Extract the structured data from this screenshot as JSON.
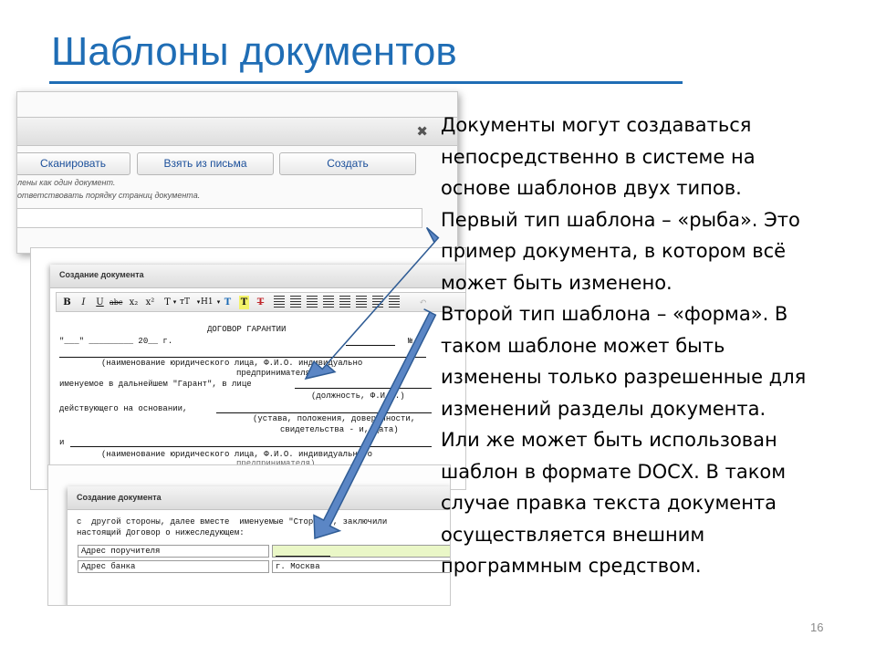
{
  "slide": {
    "title": "Шаблоны документов",
    "body_lines": [
      "Документы могут создаваться",
      "непосредственно в системе на",
      "основе шаблонов двух типов.",
      "Первый тип шаблона – «рыба». Это",
      "пример документа, в котором всё",
      "может быть изменено.",
      "Второй тип шаблона – «форма».  В",
      "таком шаблоне может быть",
      "изменены только разрешенные для",
      "изменений разделы документа.",
      "Или же может быть использован",
      "шаблон в формате DOCX. В таком",
      "случае правка текста документа",
      "осуществляется внешним",
      "программным средством."
    ],
    "page_number": "16"
  },
  "screenshot1": {
    "close_icon": "close-icon",
    "buttons": {
      "scan": "Сканировать",
      "from_mail": "Взять из письма",
      "create": "Создать"
    },
    "notes": [
      "лены как один документ.",
      "ответствовать порядку страниц документа."
    ]
  },
  "screenshot2": {
    "dialog_title": "Создание документа",
    "toolbar": {
      "bold": "B",
      "italic": "I",
      "underline": "U",
      "strike": "abc",
      "subscript": "x₂",
      "superscript": "x²",
      "font_family": "T",
      "font_size": "тT",
      "heading": "H1",
      "icons": [
        "text-color-icon",
        "highlight-icon",
        "clear-format-icon",
        "bullet-list-icon",
        "numbered-list-icon",
        "outdent-icon",
        "indent-icon",
        "align-left-icon",
        "align-center-icon",
        "align-right-icon",
        "justify-icon",
        "undo-icon"
      ]
    },
    "document_lines": {
      "heading": "ДОГОВОР ГАРАНТИИ",
      "date_line": "\"___\" _________ 20__ г.",
      "number_mark": "№",
      "legal_entity_caption": "(наименование юридического лица, Ф.И.О. индивидуально",
      "entrepreneur": "предпринимателя)",
      "named_hereafter": "именуемое в дальнейшем \"Гарант\", в лице",
      "position_caption": "(должность, Ф.И.О.)",
      "acting_basis": "действующего на основании,",
      "charter_caption": "(устава, положения, доверенности,",
      "certificate_caption": "свидетельства - и, дата)",
      "and": "и",
      "legal_entity_caption_2": "(наименование юридического лица, Ф.И.О. индивидуального",
      "cut_line": "предпринимателя)"
    }
  },
  "screenshot3": {
    "dialog_title": "Создание документа",
    "text_line_1": "с  другой стороны, далее вместе  именуемые \"Стороны\", заключили",
    "text_line_2": "настоящий Договор о нижеследующем:",
    "table": [
      [
        "Адрес поручителя",
        ""
      ],
      [
        "Адрес банка",
        "г. Москва"
      ]
    ]
  },
  "colors": {
    "title": "#1f6db5",
    "arrow_fill": "#5b86c5",
    "arrow_stroke": "#2f5c95",
    "editable_cell": "#eaf7c7"
  }
}
